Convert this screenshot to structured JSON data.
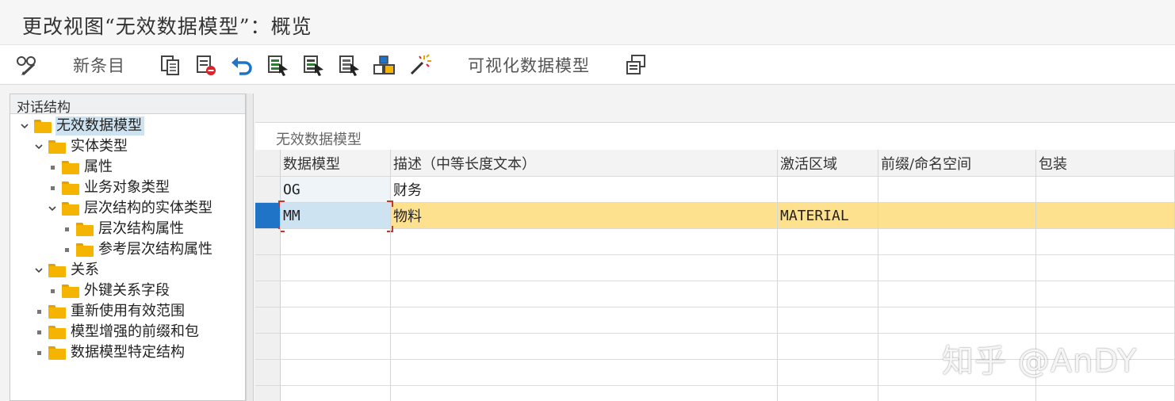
{
  "window": {
    "title": "更改视图“无效数据模型”：概览"
  },
  "toolbar": {
    "new_entries_label": "新条目",
    "visualize_label": "可视化数据模型",
    "icons": [
      "display-change-icon",
      "copy-icon",
      "delete-icon",
      "undo-icon",
      "select-all-icon",
      "select-block-icon",
      "deselect-all-icon",
      "transport-icon",
      "wizard-icon",
      "more-icon"
    ]
  },
  "tree": {
    "header": "对话结构",
    "nodes": [
      {
        "label": "无效数据模型",
        "level": 0,
        "toggle": "expanded",
        "selected": true,
        "open_folder": true
      },
      {
        "label": "实体类型",
        "level": 1,
        "toggle": "expanded"
      },
      {
        "label": "属性",
        "level": 2,
        "toggle": "leaf"
      },
      {
        "label": "业务对象类型",
        "level": 2,
        "toggle": "leaf"
      },
      {
        "label": "层次结构的实体类型",
        "level": 2,
        "toggle": "expanded"
      },
      {
        "label": "层次结构属性",
        "level": 3,
        "toggle": "leaf"
      },
      {
        "label": "参考层次结构属性",
        "level": 3,
        "toggle": "leaf"
      },
      {
        "label": "关系",
        "level": 1,
        "toggle": "expanded"
      },
      {
        "label": "外键关系字段",
        "level": 2,
        "toggle": "leaf"
      },
      {
        "label": "重新使用有效范围",
        "level": 1,
        "toggle": "leaf"
      },
      {
        "label": "模型增强的前缀和包",
        "level": 1,
        "toggle": "leaf"
      },
      {
        "label": "数据模型特定结构",
        "level": 1,
        "toggle": "leaf"
      }
    ]
  },
  "grid": {
    "title": "无效数据模型",
    "columns": [
      "数据模型",
      "描述（中等长度文本）",
      "激活区域",
      "前缀/命名空间",
      "包装"
    ],
    "rows": [
      {
        "cells": [
          "OG",
          "财务",
          "",
          "",
          ""
        ],
        "selected": false
      },
      {
        "cells": [
          "MM",
          "物料",
          "MATERIAL",
          "",
          ""
        ],
        "selected": true
      }
    ]
  },
  "colors": {
    "selected_row": "#fde18e",
    "selected_cell": "#cde3f1",
    "row_marker": "#1f74c7",
    "folder": "#f5b400",
    "tree_selection": "#cde3f1"
  },
  "watermark": "知乎 @AnDY"
}
